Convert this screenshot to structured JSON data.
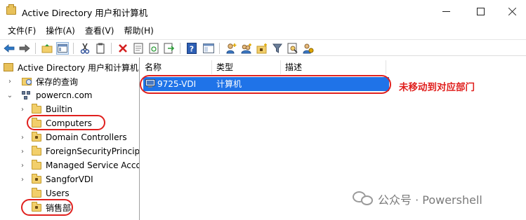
{
  "window": {
    "title": "Active Directory 用户和计算机",
    "controls": {
      "minimize": "minimize-icon",
      "maximize": "maximize-icon",
      "close": "close-icon"
    }
  },
  "menu": {
    "items": [
      {
        "label": "文件(F)"
      },
      {
        "label": "操作(A)"
      },
      {
        "label": "查看(V)"
      },
      {
        "label": "帮助(H)"
      }
    ]
  },
  "toolbar": {
    "icons": [
      "back-icon",
      "forward-icon",
      "up-folder-icon",
      "show-tree-icon",
      "cut-icon",
      "copy-icon",
      "delete-icon",
      "properties-icon",
      "refresh-icon",
      "export-icon",
      "help-icon",
      "console-icon",
      "add-user-icon",
      "add-group-icon",
      "add-ou-icon",
      "filter-icon",
      "find-icon",
      "delegate-icon"
    ]
  },
  "tree": {
    "root": "Active Directory 用户和计算机",
    "saved_queries": "保存的查询",
    "domain": "powercn.com",
    "items": [
      {
        "label": "Builtin",
        "expandable": true,
        "type": "container"
      },
      {
        "label": "Computers",
        "expandable": false,
        "type": "container"
      },
      {
        "label": "Domain Controllers",
        "expandable": true,
        "type": "ou"
      },
      {
        "label": "ForeignSecurityPrincipals",
        "expandable": true,
        "type": "container"
      },
      {
        "label": "Managed Service Accounts",
        "expandable": true,
        "type": "container"
      },
      {
        "label": "SangforVDI",
        "expandable": true,
        "type": "ou"
      },
      {
        "label": "Users",
        "expandable": false,
        "type": "container"
      },
      {
        "label": "销售部",
        "expandable": false,
        "type": "ou"
      }
    ]
  },
  "list": {
    "columns": [
      "名称",
      "类型",
      "描述"
    ],
    "rows": [
      {
        "name": "9725-VDI",
        "type": "计算机",
        "description": ""
      }
    ]
  },
  "annotation": "未移动到对应部门",
  "watermark": "公众号 · Powershell",
  "colors": {
    "selection": "#1f73e8",
    "annotation": "#e0201e"
  }
}
